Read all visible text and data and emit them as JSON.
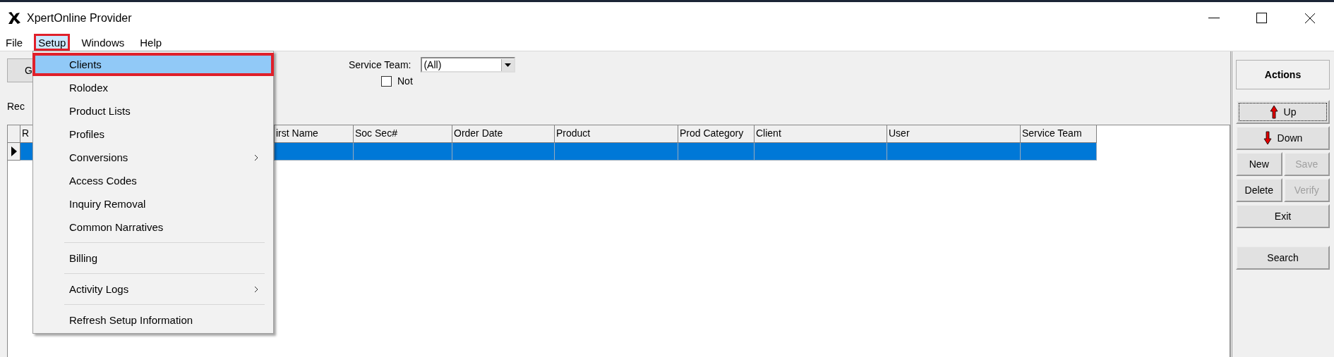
{
  "window": {
    "title": "XpertOnline Provider"
  },
  "menu_bar": [
    {
      "label": "File",
      "selected": false,
      "highlighted": false
    },
    {
      "label": "Setup",
      "selected": true,
      "highlighted": true
    },
    {
      "label": "Windows",
      "selected": false,
      "highlighted": false
    },
    {
      "label": "Help",
      "selected": false,
      "highlighted": false
    }
  ],
  "setup_menu": {
    "items": [
      {
        "kind": "item",
        "label": "Clients",
        "selected": true,
        "highlighted": true,
        "submenu": false
      },
      {
        "kind": "item",
        "label": "Rolodex",
        "selected": false,
        "highlighted": false,
        "submenu": false
      },
      {
        "kind": "item",
        "label": "Product Lists",
        "selected": false,
        "highlighted": false,
        "submenu": false
      },
      {
        "kind": "item",
        "label": "Profiles",
        "selected": false,
        "highlighted": false,
        "submenu": false
      },
      {
        "kind": "item",
        "label": "Conversions",
        "selected": false,
        "highlighted": false,
        "submenu": true
      },
      {
        "kind": "item",
        "label": "Access Codes",
        "selected": false,
        "highlighted": false,
        "submenu": false
      },
      {
        "kind": "item",
        "label": "Inquiry Removal",
        "selected": false,
        "highlighted": false,
        "submenu": false
      },
      {
        "kind": "item",
        "label": "Common Narratives",
        "selected": false,
        "highlighted": false,
        "submenu": false
      },
      {
        "kind": "separator"
      },
      {
        "kind": "item",
        "label": "Billing",
        "selected": false,
        "highlighted": false,
        "submenu": false
      },
      {
        "kind": "separator"
      },
      {
        "kind": "item",
        "label": "Activity Logs",
        "selected": false,
        "highlighted": false,
        "submenu": true
      },
      {
        "kind": "separator"
      },
      {
        "kind": "item",
        "label": "Refresh Setup Information",
        "selected": false,
        "highlighted": false,
        "submenu": false
      }
    ]
  },
  "toolbar": {
    "button": "G",
    "service_team": {
      "label": "Service Team:",
      "value": "(All)"
    },
    "not_checkbox": {
      "label": "Not",
      "checked": false
    }
  },
  "section_label": "Rec",
  "table": {
    "columns": [
      "R",
      "irst Name",
      "Soc Sec#",
      "Order Date",
      "Product",
      "Prod Category",
      "Client",
      "User",
      "Service Team"
    ],
    "rows": [
      {
        "selected": true
      }
    ]
  },
  "actions": {
    "title": "Actions",
    "button_rows": [
      [
        {
          "label": "Up",
          "kind": "up",
          "disabled": false,
          "focused": true
        }
      ],
      [
        {
          "label": "Down",
          "kind": "down",
          "disabled": false,
          "focused": false
        }
      ],
      [
        {
          "label": "New",
          "kind": "plain",
          "disabled": false,
          "focused": false
        },
        {
          "label": "Save",
          "kind": "plain",
          "disabled": true,
          "focused": false
        }
      ],
      [
        {
          "label": "Delete",
          "kind": "plain",
          "disabled": false,
          "focused": false
        },
        {
          "label": "Verify",
          "kind": "plain",
          "disabled": true,
          "focused": false
        }
      ],
      [
        {
          "label": "Exit",
          "kind": "plain",
          "disabled": false,
          "focused": false
        }
      ],
      [
        {
          "label": "Search",
          "kind": "plain",
          "disabled": false,
          "focused": false
        }
      ]
    ]
  }
}
